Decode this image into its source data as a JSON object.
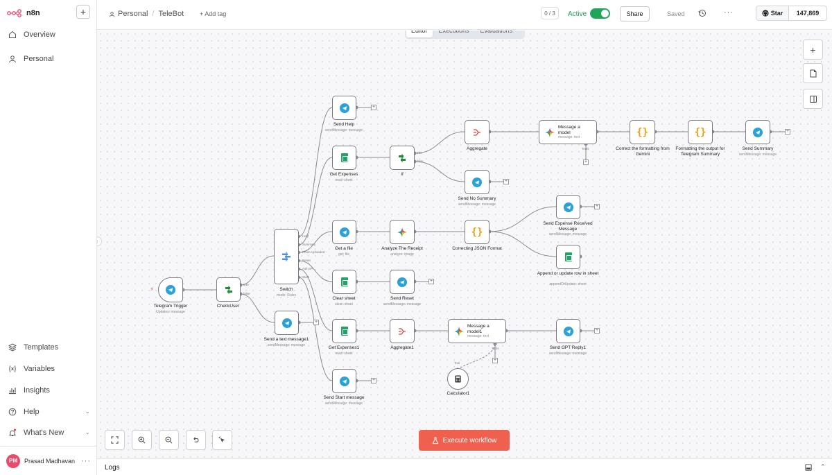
{
  "app": {
    "brand": "n8n"
  },
  "sidebar": {
    "items": [
      {
        "label": "Overview",
        "icon": "home-icon"
      },
      {
        "label": "Personal",
        "icon": "user-icon"
      }
    ],
    "bottom_items": [
      {
        "label": "Templates",
        "icon": "templates-icon"
      },
      {
        "label": "Variables",
        "icon": "variables-icon"
      },
      {
        "label": "Insights",
        "icon": "insights-icon"
      },
      {
        "label": "Help",
        "icon": "help-icon"
      },
      {
        "label": "What's New",
        "icon": "bell-icon"
      }
    ],
    "user": {
      "initials": "PM",
      "name": "Prasad Madhavan"
    }
  },
  "header": {
    "crumb_project": "Personal",
    "separator": "/",
    "crumb_workflow": "TeleBot",
    "add_tag": "+ Add tag",
    "counter": "0 / 3",
    "active_label": "Active",
    "share": "Share",
    "saved": "Saved",
    "github_star": "Star",
    "github_count": "147,869"
  },
  "tabs": [
    "Editor",
    "Executions",
    "Evaluations"
  ],
  "execute_label": "Execute workflow",
  "logs_label": "Logs",
  "colors": {
    "accent": "#f0604f",
    "active": "#22a55b",
    "telegram": "#2aa1d9",
    "sheets": "#1fa463"
  },
  "nodes": {
    "telegram_trigger": {
      "label": "Telegram Trigger",
      "sub": "Updates: message"
    },
    "check_user": {
      "label": "CheckUser",
      "sub": ""
    },
    "switch": {
      "label": "Switch",
      "sub": "mode: Rules"
    },
    "send_text": {
      "label": "Send a text message1",
      "sub": "sendMessage: message"
    },
    "send_help": {
      "label": "Send Help",
      "sub": "sendMessage: message"
    },
    "get_expenses": {
      "label": "Get Expenses",
      "sub": "read: sheet"
    },
    "if": {
      "label": "If",
      "sub": ""
    },
    "aggregate": {
      "label": "Aggregate",
      "sub": ""
    },
    "send_no_summary": {
      "label": "Send No Summary",
      "sub": "sendMessage: message"
    },
    "message_model": {
      "label": "Message a model",
      "sub": "message: text"
    },
    "correct_format": {
      "label": "Correct the formatting from Gemini",
      "sub": ""
    },
    "format_output": {
      "label": "Formatting the output for Telegram Summary",
      "sub": ""
    },
    "send_summary": {
      "label": "Send Summary",
      "sub": "sendMessage: message"
    },
    "get_file": {
      "label": "Get a file",
      "sub": "get: file"
    },
    "analyze_receipt": {
      "label": "Analyze The Receipt",
      "sub": "analyze: image"
    },
    "correcting_json": {
      "label": "Correcting JSON Format",
      "sub": ""
    },
    "send_expense_received": {
      "label": "Send Expense Received Message",
      "sub": "sendMessage: message"
    },
    "append_row": {
      "label": "Append or update row in sheet",
      "sub": "appendOrUpdate: sheet"
    },
    "clear_sheet": {
      "label": "Clear sheet",
      "sub": "clear: sheet"
    },
    "send_reset": {
      "label": "Send Reset",
      "sub": "sendMessage: message"
    },
    "get_expenses1": {
      "label": "Get Expenses1",
      "sub": "read: sheet"
    },
    "aggregate1": {
      "label": "Aggregate1",
      "sub": ""
    },
    "message_model1": {
      "label": "Message a model1",
      "sub": "message: text"
    },
    "send_gpt": {
      "label": "Send GPT Reply1",
      "sub": "sendMessage: message"
    },
    "calculator": {
      "label": "Calculator1",
      "sub": ""
    },
    "send_start": {
      "label": "Send Start message",
      "sub": "sendMessage: message"
    }
  },
  "port_labels": {
    "checkuser_true": "true",
    "checkuser_false": "false",
    "if_true": "true",
    "if_false": "false",
    "switch_outputs": [
      "Help",
      "Summary",
      "Photo Uploaded",
      "Reset",
      "Ask GP",
      "Start"
    ],
    "tools": "Tools",
    "tool": "Tool"
  }
}
